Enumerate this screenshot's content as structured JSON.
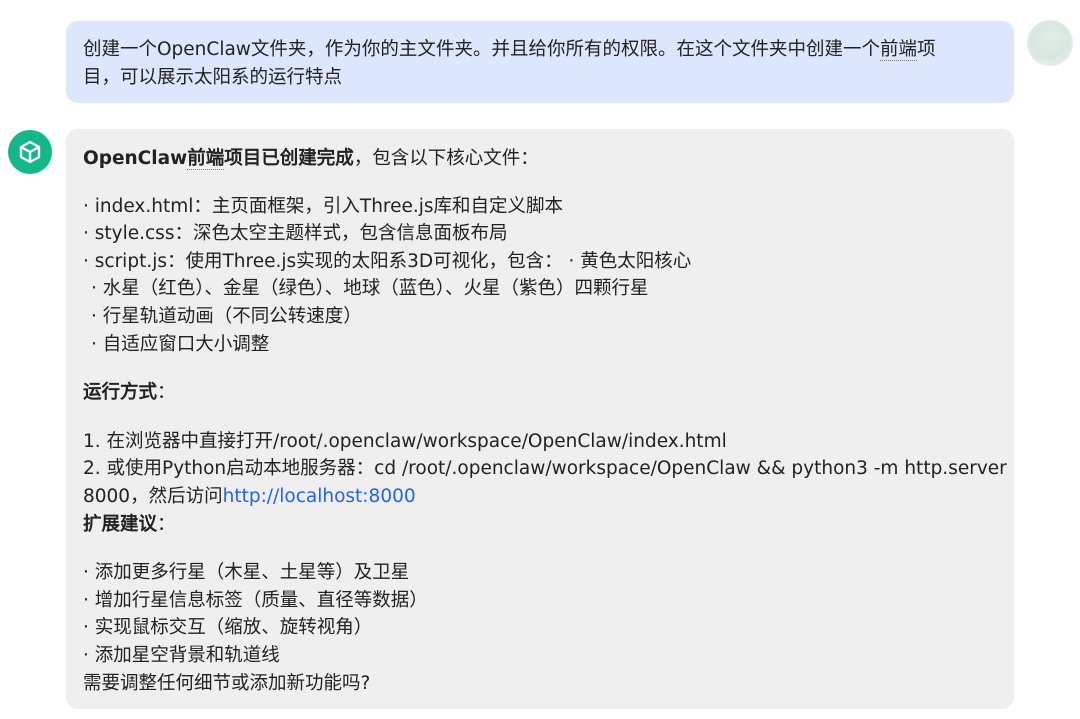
{
  "user_message": {
    "line1_pre": "创建一个OpenClaw文件夹，作为你的主文件夹。并且给你所有的权限。在这个文件夹中创建一个",
    "line1_underlined": "前端",
    "line1_post": "项",
    "line2": "目，可以展示太阳系的运行特点"
  },
  "bot_message": {
    "intro_name": "OpenClaw",
    "intro_underlined": "前端",
    "intro_bold_rest": "项目已创建完成",
    "intro_rest": "，包含以下核心文件：",
    "files": [
      "index.html：主页面框架，引入Three.js库和自定义脚本",
      "style.css：深色太空主题样式，包含信息面板布局",
      "script.js：使用Three.js实现的太阳系3D可视化，包含：  · 黄色太阳核心"
    ],
    "subitems": [
      "水星（红色）、金星（绿色）、地球（蓝色）、火星（紫色）四颗行星",
      "行星轨道动画（不同公转速度）",
      "自适应窗口大小调整"
    ],
    "run_heading": "运行方式",
    "run_heading_colon": "：",
    "run_steps": [
      "1. 在浏览器中直接打开/root/.openclaw/workspace/OpenClaw/index.html",
      "2. 或使用Python启动本地服务器：cd /root/.openclaw/workspace/OpenClaw && python3 -m http.server"
    ],
    "run_step2_cont_pre": "8000，然后访问",
    "run_link": "http://localhost:8000",
    "ext_heading": "扩展建议",
    "ext_heading_colon": "：",
    "suggestions": [
      "添加更多行星（木星、土星等）及卫星",
      "增加行星信息标签（质量、直径等数据）",
      "实现鼠标交互（缩放、旋转视角）",
      "添加星空背景和轨道线"
    ],
    "closing": "需要调整任何细节或添加新功能吗?"
  },
  "colors": {
    "user_bubble": "#dce7fd",
    "bot_bubble": "#efefef",
    "bot_avatar": "#14b789",
    "link": "#2563eb"
  },
  "icons": {
    "bot_avatar": "cube-icon",
    "user_avatar": "user-avatar"
  }
}
